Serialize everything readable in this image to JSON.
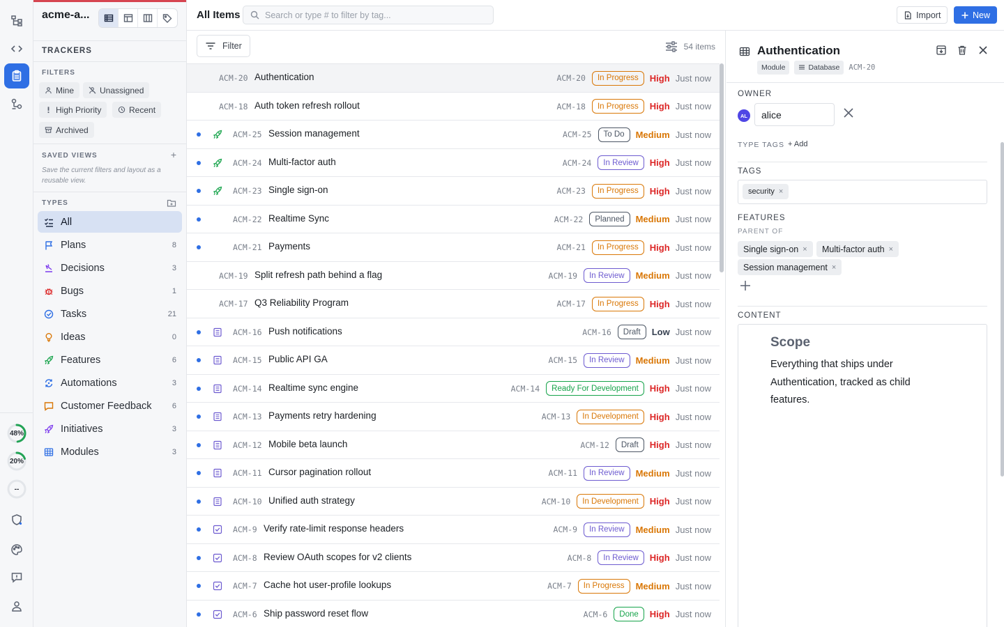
{
  "workspace": {
    "name": "acme-a..."
  },
  "sidebar": {
    "trackers_label": "TRACKERS",
    "filters_label": "FILTERS",
    "filters": [
      {
        "label": "Mine",
        "icon": "person-icon"
      },
      {
        "label": "Unassigned",
        "icon": "person-off-icon"
      },
      {
        "label": "High Priority",
        "icon": "exclamation-icon"
      },
      {
        "label": "Recent",
        "icon": "clock-icon"
      },
      {
        "label": "Archived",
        "icon": "archive-icon"
      }
    ],
    "saved_views_label": "SAVED VIEWS",
    "saved_views_hint": "Save the current filters and layout as a reusable view.",
    "types_label": "TYPES",
    "types": [
      {
        "label": "All",
        "count": "",
        "icon": "checklist-icon",
        "color": "#1f2a44"
      },
      {
        "label": "Plans",
        "count": "8",
        "icon": "flag-icon",
        "color": "#2f6fe4"
      },
      {
        "label": "Decisions",
        "count": "3",
        "icon": "scale-icon",
        "color": "#7c3aed"
      },
      {
        "label": "Bugs",
        "count": "1",
        "icon": "bug-icon",
        "color": "#dc2626"
      },
      {
        "label": "Tasks",
        "count": "21",
        "icon": "check-circle-icon",
        "color": "#2f6fe4"
      },
      {
        "label": "Ideas",
        "count": "0",
        "icon": "lightbulb-icon",
        "color": "#d97706"
      },
      {
        "label": "Features",
        "count": "6",
        "icon": "rocket-icon",
        "color": "#16a34a"
      },
      {
        "label": "Automations",
        "count": "3",
        "icon": "refresh-icon",
        "color": "#2f6fe4"
      },
      {
        "label": "Customer Feedback",
        "count": "6",
        "icon": "comment-icon",
        "color": "#d97706"
      },
      {
        "label": "Initiatives",
        "count": "3",
        "icon": "rocket-icon",
        "color": "#7c3aed"
      },
      {
        "label": "Modules",
        "count": "3",
        "icon": "grid-icon",
        "color": "#2f6fe4"
      }
    ]
  },
  "rail": {
    "ring1": "48%",
    "ring2": "20%",
    "ring3": "--",
    "ring1_value": 0.48,
    "ring2_value": 0.2
  },
  "header": {
    "title": "All Items",
    "search_placeholder": "Search or type # to filter by tag...",
    "import_label": "Import",
    "new_label": "New"
  },
  "list": {
    "filter_label": "Filter",
    "count_label": "54 items",
    "rows": [
      {
        "key": "ACM-20",
        "title": "Authentication",
        "status": "In Progress",
        "priority": "High",
        "time": "Just now",
        "dot": false,
        "icon": "",
        "selected": true
      },
      {
        "key": "ACM-18",
        "title": "Auth token refresh rollout",
        "status": "In Progress",
        "priority": "High",
        "time": "Just now",
        "dot": false,
        "icon": ""
      },
      {
        "key": "ACM-25",
        "title": "Session management",
        "status": "To Do",
        "priority": "Medium",
        "time": "Just now",
        "dot": true,
        "icon": "rocket-icon"
      },
      {
        "key": "ACM-24",
        "title": "Multi-factor auth",
        "status": "In Review",
        "priority": "High",
        "time": "Just now",
        "dot": true,
        "icon": "rocket-icon"
      },
      {
        "key": "ACM-23",
        "title": "Single sign-on",
        "status": "In Progress",
        "priority": "High",
        "time": "Just now",
        "dot": true,
        "icon": "rocket-icon"
      },
      {
        "key": "ACM-22",
        "title": "Realtime Sync",
        "status": "Planned",
        "priority": "Medium",
        "time": "Just now",
        "dot": true,
        "icon": "blank"
      },
      {
        "key": "ACM-21",
        "title": "Payments",
        "status": "In Progress",
        "priority": "High",
        "time": "Just now",
        "dot": true,
        "icon": "blank"
      },
      {
        "key": "ACM-19",
        "title": "Split refresh path behind a flag",
        "status": "In Review",
        "priority": "Medium",
        "time": "Just now",
        "dot": false,
        "icon": ""
      },
      {
        "key": "ACM-17",
        "title": "Q3 Reliability Program",
        "status": "In Progress",
        "priority": "High",
        "time": "Just now",
        "dot": false,
        "icon": ""
      },
      {
        "key": "ACM-16",
        "title": "Push notifications",
        "status": "Draft",
        "priority": "Low",
        "time": "Just now",
        "dot": true,
        "icon": "doc-icon"
      },
      {
        "key": "ACM-15",
        "title": "Public API GA",
        "status": "In Review",
        "priority": "Medium",
        "time": "Just now",
        "dot": true,
        "icon": "doc-icon"
      },
      {
        "key": "ACM-14",
        "title": "Realtime sync engine",
        "status": "Ready For Development",
        "priority": "High",
        "time": "Just now",
        "dot": true,
        "icon": "doc-icon"
      },
      {
        "key": "ACM-13",
        "title": "Payments retry hardening",
        "status": "In Development",
        "priority": "High",
        "time": "Just now",
        "dot": true,
        "icon": "doc-icon"
      },
      {
        "key": "ACM-12",
        "title": "Mobile beta launch",
        "status": "Draft",
        "priority": "High",
        "time": "Just now",
        "dot": true,
        "icon": "doc-icon"
      },
      {
        "key": "ACM-11",
        "title": "Cursor pagination rollout",
        "status": "In Review",
        "priority": "Medium",
        "time": "Just now",
        "dot": true,
        "icon": "doc-icon"
      },
      {
        "key": "ACM-10",
        "title": "Unified auth strategy",
        "status": "In Development",
        "priority": "High",
        "time": "Just now",
        "dot": true,
        "icon": "doc-icon"
      },
      {
        "key": "ACM-9",
        "title": "Verify rate-limit response headers",
        "status": "In Review",
        "priority": "Medium",
        "time": "Just now",
        "dot": true,
        "icon": "checkbox-icon"
      },
      {
        "key": "ACM-8",
        "title": "Review OAuth scopes for v2 clients",
        "status": "In Review",
        "priority": "High",
        "time": "Just now",
        "dot": true,
        "icon": "checkbox-icon"
      },
      {
        "key": "ACM-7",
        "title": "Cache hot user-profile lookups",
        "status": "In Progress",
        "priority": "Medium",
        "time": "Just now",
        "dot": true,
        "icon": "checkbox-icon"
      },
      {
        "key": "ACM-6",
        "title": "Ship password reset flow",
        "status": "Done",
        "priority": "High",
        "time": "Just now",
        "dot": true,
        "icon": "checkbox-icon"
      }
    ]
  },
  "status_colors": {
    "In Progress": "#d97706",
    "To Do": "#4b5563",
    "In Review": "#6d5bd0",
    "Planned": "#4b5563",
    "Draft": "#4b5563",
    "Ready For Development": "#16a34a",
    "In Development": "#d97706",
    "Done": "#16a34a"
  },
  "priority_colors": {
    "High": "#dc2626",
    "Medium": "#d97706",
    "Low": "#374151"
  },
  "detail": {
    "title": "Authentication",
    "type_pill": "Module",
    "db_pill": "Database",
    "id": "ACM-20",
    "owner_label": "OWNER",
    "owner_initials": "AL",
    "owner_name": "alice",
    "type_tags_label": "TYPE TAGS",
    "add_label": "+ Add",
    "tags_label": "TAGS",
    "tags": [
      "security"
    ],
    "features_label": "FEATURES",
    "parent_of_label": "PARENT OF",
    "features": [
      "Single sign-on",
      "Multi-factor auth",
      "Session management"
    ],
    "content_label": "CONTENT",
    "content_heading": "Scope",
    "content_body": "Everything that ships under Authentication, tracked as child features."
  }
}
